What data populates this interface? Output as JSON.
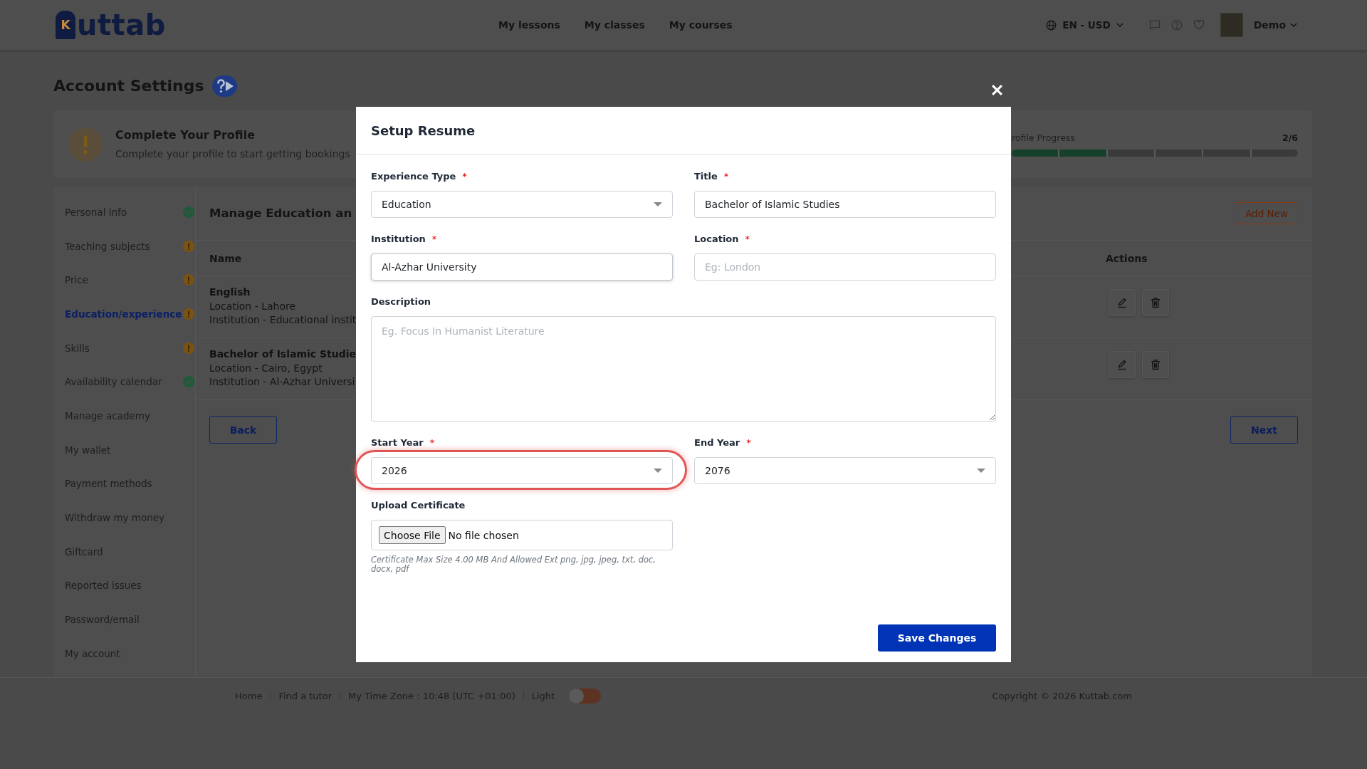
{
  "header": {
    "logo": {
      "initial": "K",
      "wordmark": "uttab"
    },
    "nav": [
      "My lessons",
      "My classes",
      "My courses"
    ],
    "locale": "EN - USD",
    "user": {
      "name": "Demo"
    }
  },
  "page": {
    "title": "Account Settings"
  },
  "profile_banner": {
    "title": "Complete Your Profile",
    "text": "Complete your profile to start getting bookings",
    "progress": {
      "label": "rofile Progress",
      "count": "2/6",
      "steps": [
        {
          "done": true
        },
        {
          "done": true
        },
        {
          "done": false
        },
        {
          "done": false
        },
        {
          "done": false
        },
        {
          "done": false
        }
      ]
    }
  },
  "sidebar": {
    "items": [
      {
        "label": "Personal info",
        "selected": false,
        "completed": true
      },
      {
        "label": "Teaching subjects",
        "selected": false,
        "completed": false
      },
      {
        "label": "Price",
        "selected": false,
        "completed": false
      },
      {
        "label": "Education/experience",
        "selected": true,
        "completed": false
      },
      {
        "label": "Skills",
        "selected": false,
        "completed": false
      },
      {
        "label": "Availability calendar",
        "selected": false,
        "completed": true
      },
      {
        "label": "Manage academy",
        "selected": false
      },
      {
        "label": "My wallet",
        "selected": false
      },
      {
        "label": "Payment methods",
        "selected": false
      },
      {
        "label": "Withdraw my money",
        "selected": false
      },
      {
        "label": "Giftcard",
        "selected": false
      },
      {
        "label": "Reported issues",
        "selected": false
      },
      {
        "label": "Password/email",
        "selected": false
      },
      {
        "label": "My account",
        "selected": false
      }
    ]
  },
  "panel": {
    "title": "Manage Education an",
    "add_button": "Add New",
    "columns": [
      "Name",
      "Actions"
    ],
    "rows": [
      {
        "name": "English",
        "location": "Location - Lahore",
        "institution": "Institution - Educational instit"
      },
      {
        "name": "Bachelor of Islamic Studie",
        "location": "Location - Cairo, Egypt",
        "institution": "Institution - Al-Azhar Universi"
      }
    ],
    "back_button": "Back",
    "next_button": "Next"
  },
  "footer": {
    "links": [
      "Home",
      "Find a tutor"
    ],
    "timezone": "My Time Zone : 10:48 (UTC +01:00)",
    "theme_toggle": {
      "label": "Light",
      "on": false
    },
    "copyright": "Copyright © 2026 Kuttab.com"
  },
  "modal": {
    "title": "Setup Resume",
    "fields": [
      {
        "kind": "select",
        "label": "Experience Type",
        "required_mark": "*",
        "value": "Education",
        "focused": false,
        "highlighted": false
      },
      {
        "kind": "text",
        "label": "Title",
        "required_mark": "*",
        "value": "Bachelor of Islamic Studies",
        "focused": false,
        "highlighted": false
      },
      {
        "kind": "text",
        "label": "Institution",
        "required_mark": "*",
        "value": "Al-Azhar University",
        "focused": true,
        "highlighted": false
      },
      {
        "kind": "text",
        "label": "Location",
        "required_mark": "*",
        "placeholder": "Eg: London",
        "focused": false,
        "highlighted": false
      },
      {
        "kind": "textarea",
        "label": "Description",
        "placeholder": "Eg. Focus In Humanist Literature",
        "focused": false,
        "highlighted": false
      },
      {
        "kind": "select",
        "label": "Start Year",
        "required_mark": "*",
        "value": "2026",
        "focused": false,
        "highlighted": true
      },
      {
        "kind": "select",
        "label": "End Year",
        "required_mark": "*",
        "value": "2076",
        "focused": false,
        "highlighted": false
      },
      {
        "kind": "file",
        "label": "Upload Certificate",
        "button": "Choose File",
        "status": "No file chosen",
        "hint": "Certificate Max Size 4.00 MB And Allowed Ext png, jpg, jpeg, txt, doc, docx, pdf",
        "focused": false,
        "highlighted": false
      }
    ],
    "save_button": "Save Changes"
  }
}
